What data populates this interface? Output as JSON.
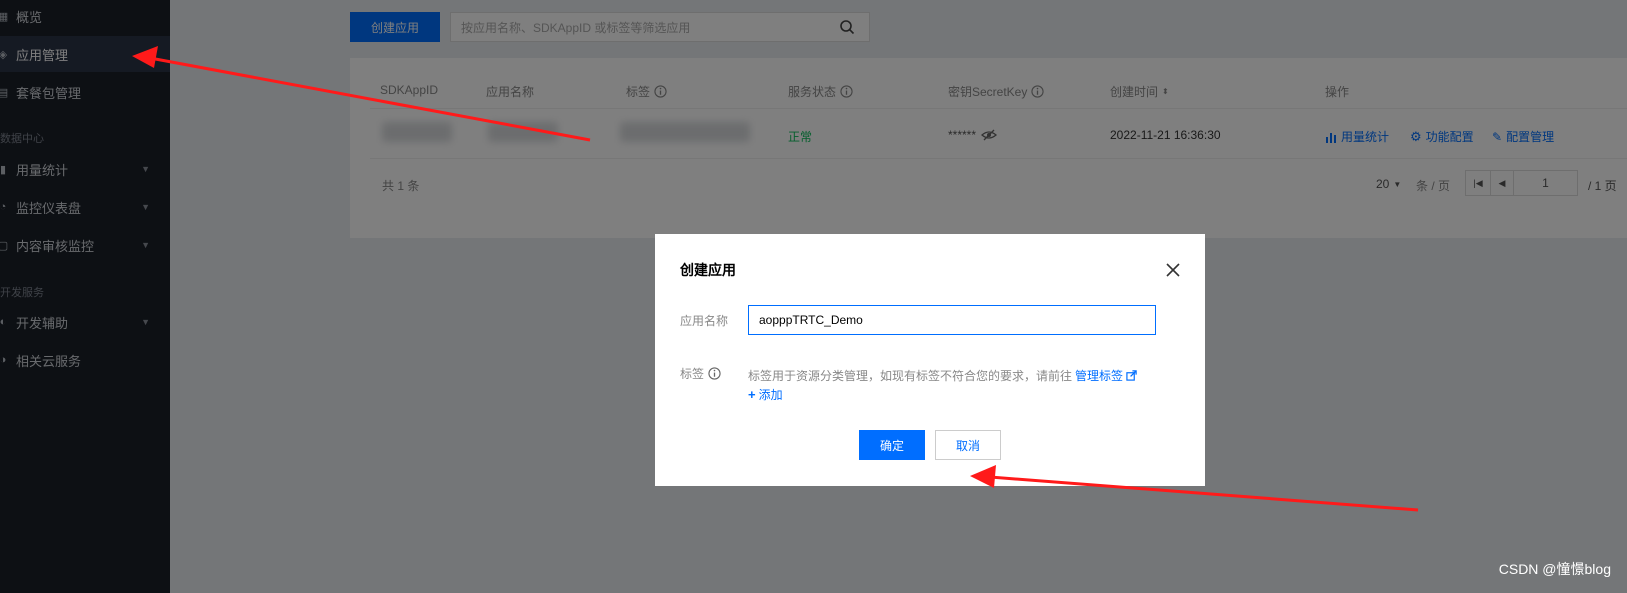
{
  "sidebar": {
    "items": [
      {
        "label": "概览",
        "icon": "overview-icon"
      },
      {
        "label": "应用管理",
        "icon": "app-icon"
      },
      {
        "label": "套餐包管理",
        "icon": "package-icon"
      },
      {
        "label": "用量统计",
        "icon": "stats-icon"
      },
      {
        "label": "监控仪表盘",
        "icon": "monitor-icon"
      },
      {
        "label": "内容审核监控",
        "icon": "audit-icon"
      },
      {
        "label": "开发辅助",
        "icon": "dev-icon"
      },
      {
        "label": "相关云服务",
        "icon": "cloud-icon"
      }
    ],
    "groups": [
      "数据中心",
      "开发服务"
    ]
  },
  "toolbar": {
    "create_label": "创建应用",
    "search_placeholder": "按应用名称、SDKAppID 或标签等筛选应用"
  },
  "table": {
    "headers": [
      "SDKAppID",
      "应用名称",
      "标签",
      "服务状态",
      "密钥SecretKey",
      "创建时间",
      "操作"
    ],
    "row": {
      "status": "正常",
      "secret": "******",
      "created": "2022-11-21 16:36:30",
      "actions": [
        "用量统计",
        "功能配置",
        "配置管理"
      ]
    },
    "total": "共 1 条",
    "page_size": "20",
    "page_size_unit": "条 / 页",
    "page_input": "1",
    "page_total": "/ 1 页"
  },
  "dialog": {
    "title": "创建应用",
    "name_label": "应用名称",
    "name_value": "aopppTRTC_Demo",
    "tag_label": "标签",
    "tag_desc": "标签用于资源分类管理，如现有标签不符合您的要求，请前往",
    "tag_manage": "管理标签",
    "add_label": "添加",
    "ok_label": "确定",
    "cancel_label": "取消"
  },
  "watermark": "CSDN @憧憬blog",
  "colors": {
    "primary": "#006eff",
    "sidebar": "#1b2029",
    "success": "#0abf5b",
    "annotation": "#ff1a1a"
  }
}
